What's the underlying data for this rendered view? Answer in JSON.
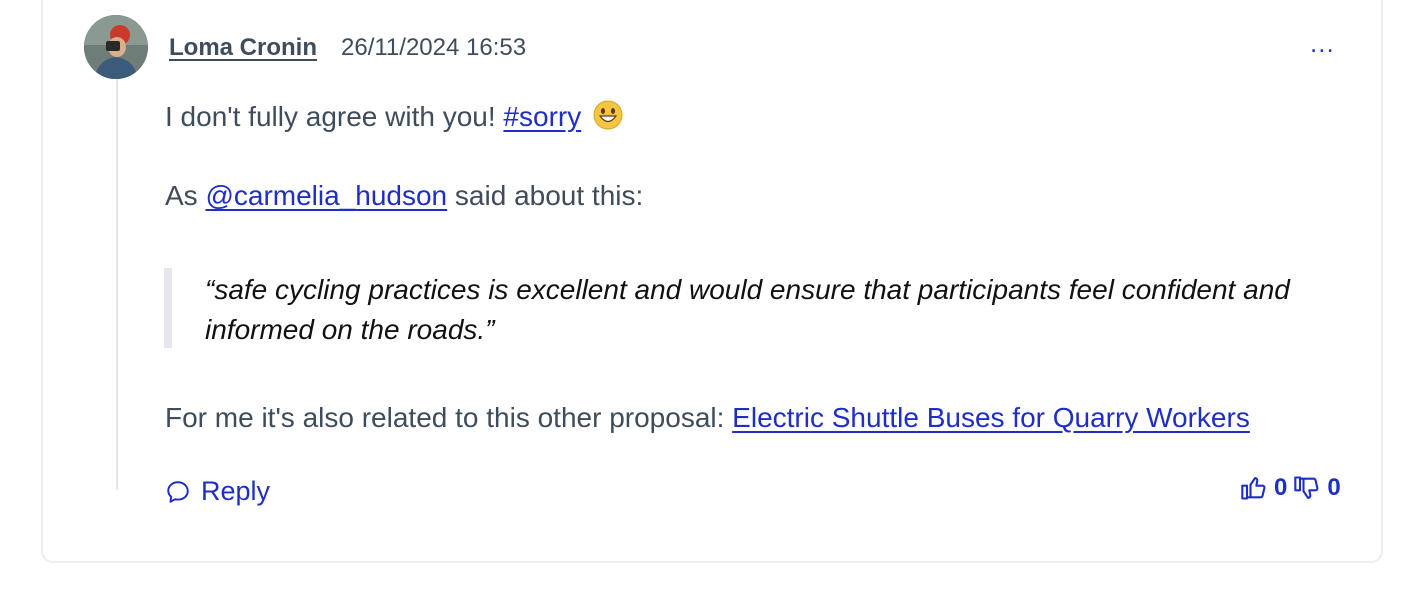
{
  "comment": {
    "author": "Loma Cronin",
    "date": "26/11/2024 16:53",
    "more_label": "...",
    "line1_text": "I don't fully agree with you!",
    "hashtag": "#sorry",
    "emoji_icon": "grinning-face-emoji",
    "line2_prefix": "As",
    "mention": "@carmelia_hudson",
    "line2_suffix": "said about this:",
    "quote": "“safe cycling practices is excellent and would ensure that participants feel confident and informed on the roads.”",
    "line3_text": "For me it's also related to this other proposal:",
    "proposal_link": "Electric Shuttle Buses for Quarry Workers"
  },
  "actions": {
    "reply_label": "Reply",
    "upvotes": "0",
    "downvotes": "0"
  },
  "colors": {
    "link": "#1f2ec4",
    "text": "#3e4c5c",
    "border": "#eceef2"
  }
}
